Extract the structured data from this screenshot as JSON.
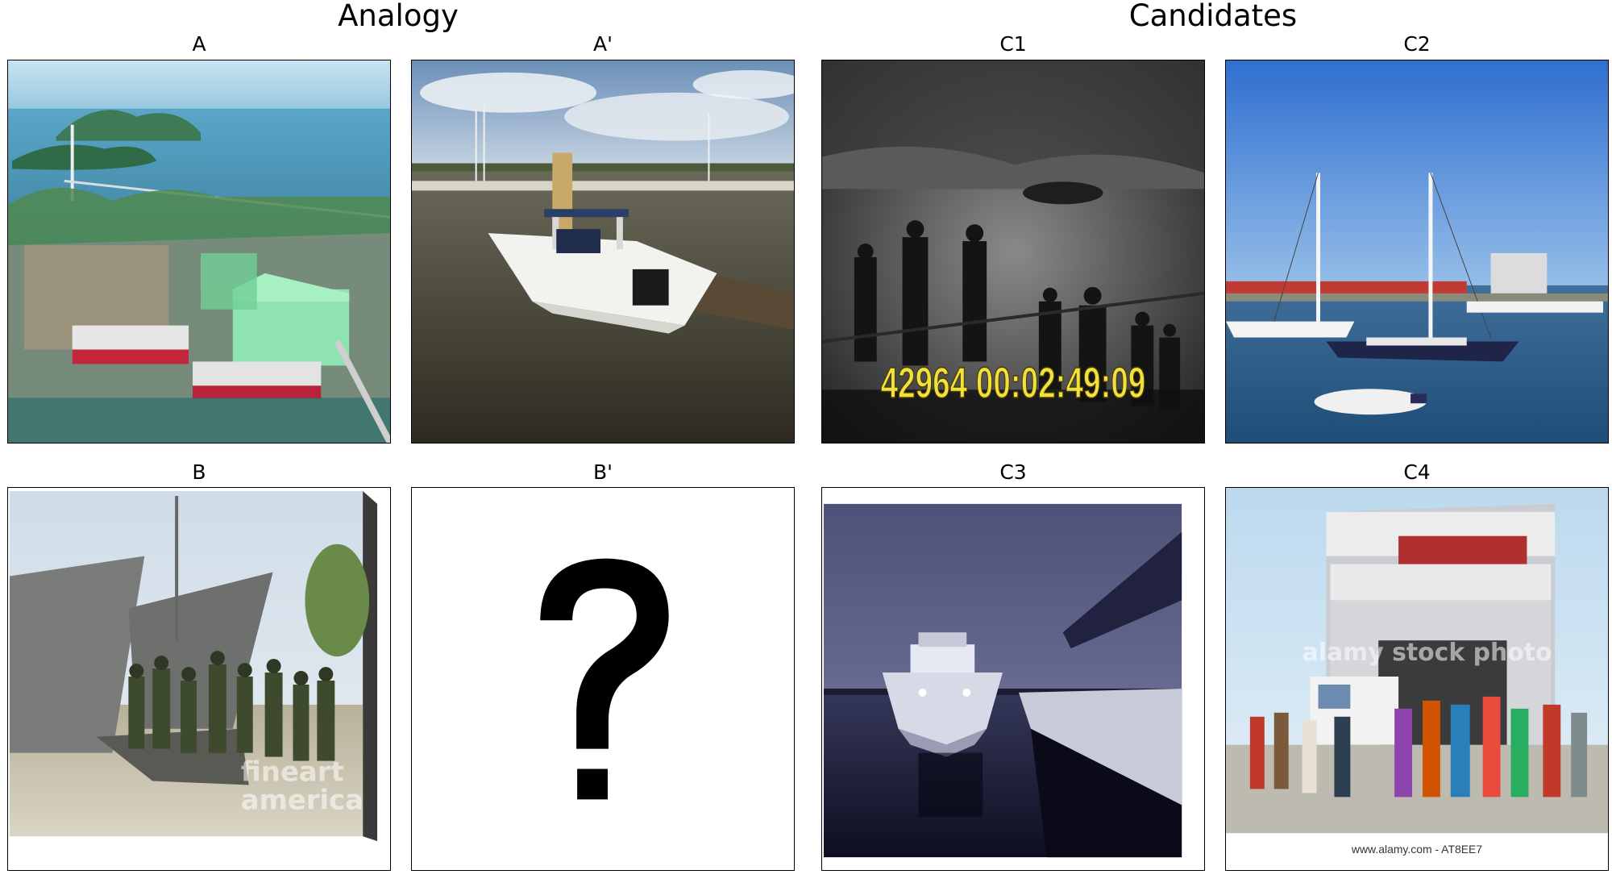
{
  "headers": {
    "analogy": "Analogy",
    "candidates": "Candidates"
  },
  "panels": {
    "a": {
      "label": "A",
      "icon": "island-shipyard-photo"
    },
    "a_prime": {
      "label": "A'",
      "icon": "motorboat-marina-photo"
    },
    "b": {
      "label": "B",
      "icon": "landing-craft-soldiers-photo",
      "watermark_lines": [
        "fineart",
        "america"
      ]
    },
    "b_prime": {
      "label": "B'",
      "icon": "question-mark"
    },
    "c1": {
      "label": "C1",
      "icon": "archival-film-still",
      "timecode": "42964 00:02:49:09"
    },
    "c2": {
      "label": "C2",
      "icon": "sailboats-harbor-photo"
    },
    "c3": {
      "label": "C3",
      "icon": "boat-at-night-photo"
    },
    "c4": {
      "label": "C4",
      "icon": "ferry-passengers-photo",
      "watermark": "alamy stock photo",
      "caption": "www.alamy.com - AT8EE7"
    }
  },
  "colors": {
    "border": "#000000",
    "timecode": "#f0e040"
  }
}
